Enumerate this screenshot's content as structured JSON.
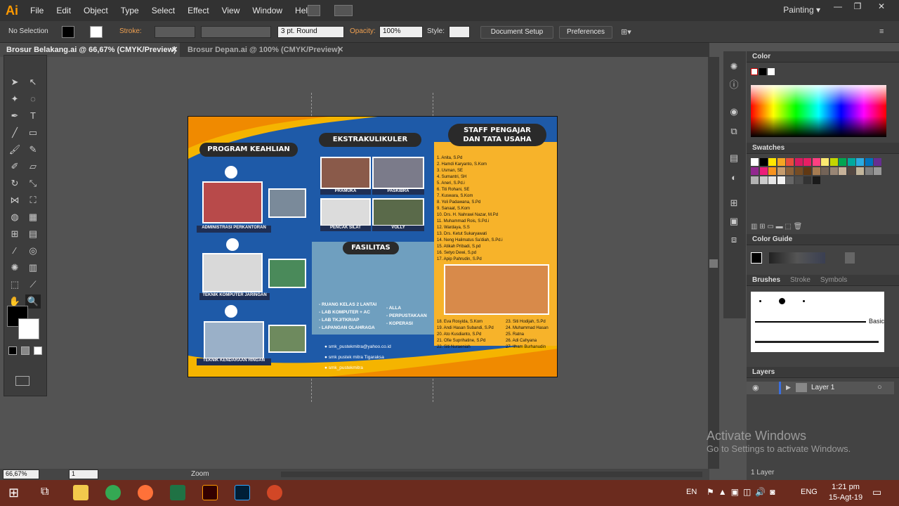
{
  "app": {
    "logo": "Ai",
    "workspace": "Painting"
  },
  "menu": [
    "File",
    "Edit",
    "Object",
    "Type",
    "Select",
    "Effect",
    "View",
    "Window",
    "Help"
  ],
  "control": {
    "selection": "No Selection",
    "stroke_label": "Stroke:",
    "brush": "3 pt. Round",
    "opacity_label": "Opacity:",
    "opacity": "100%",
    "style_label": "Style:",
    "doc_setup": "Document Setup",
    "preferences": "Preferences"
  },
  "tabs": [
    "Brosur Belakang.ai @ 66,67% (CMYK/Preview)",
    "Brosur Depan.ai @ 100% (CMYK/Preview)"
  ],
  "status": {
    "zoom": "66,67%",
    "page": "1",
    "tool": "Zoom"
  },
  "panels": {
    "color": "Color",
    "swatches": "Swatches",
    "color_guide": "Color Guide",
    "brushes": "Brushes",
    "stroke": "Stroke",
    "symbols": "Symbols",
    "brush_basic": "Basic",
    "layers": "Layers",
    "layer1": "Layer 1",
    "layer_count": "1 Layer"
  },
  "activate": {
    "title": "Activate Windows",
    "sub": "Go to Settings to activate Windows."
  },
  "taskbar": {
    "lang": "EN",
    "ime": "ENG",
    "time": "1:21 pm",
    "date": "15-Agt-19"
  },
  "brochure": {
    "program_title": "PROGRAM KEAHLIAN",
    "programs": [
      "ADMINISTRASI PERKANTORAN",
      "TEKNIK KOMPUTER JARINGAN",
      "TEKNIK KENDARAAN RINGAN"
    ],
    "ekskul_title": "EKSTRAKULIKULER",
    "ekskul": [
      "PRAMUKA",
      "PASKIBRA",
      "PENCAK SILAT",
      "VOLLY"
    ],
    "fasilitas_title": "FASILITAS",
    "fasilitas_left": [
      "RUANG KELAS 2 LANTAI",
      "LAB KOMPUTER + AC",
      "LAB TKJ/TKR/AP",
      "LAPANGAN OLAHRAGA"
    ],
    "fasilitas_right": [
      "ALLA",
      "PERPUSTAKAAN",
      "KOPERASI"
    ],
    "contact": [
      "smk_pustekmitra@yahoo.co.id",
      "smk pustek mitra Tigaraksa",
      "smk_pustekmitra"
    ],
    "staff_title1": "STAFF PENGAJAR",
    "staff_title2": "DAN TATA USAHA",
    "staff": [
      "1. Anita, S.Pd",
      "2. Hamdi Karyanto, S.Kom",
      "3. Usman, SE",
      "4. Sumantri, SH",
      "5. Aneri, S.Pd.i",
      "6. Titi Rohani, SE",
      "7. Kuswara, S.Kom",
      "8. Yoli Padawana, S.Pd",
      "9. Sanaat, S.Kom",
      "10. Drs. H. Nahrawi Nazar, M.Pd",
      "11. Muhammad Rois, S.Pd.i",
      "12. Wardaya, S.S",
      "13. Drs. Ketut Sukaryawati",
      "14. Neng Halimatus Sa'diah, S.Pd.i",
      "15. Atikah Pribadi, S.pd",
      "16. Setyo Dewi, S.pd",
      "17. Apip Pahrudin, S.Pd"
    ],
    "staff2_left": [
      "18. Eva Rosyida, S.Kom",
      "19. Andi Hasan Subandi, S.Pd",
      "20. Ato Kusdianto, S.Pd",
      "21. Ofie Suprihatine, S.Pd",
      "22. Siti Nuraeniah"
    ],
    "staff2_right": [
      "23. Siti Hodijah, S.Pd",
      "24. Muhammad Hasan",
      "25. Ratna",
      "26. Adi Cahyana",
      "27. Ilham Burhanudin"
    ]
  }
}
